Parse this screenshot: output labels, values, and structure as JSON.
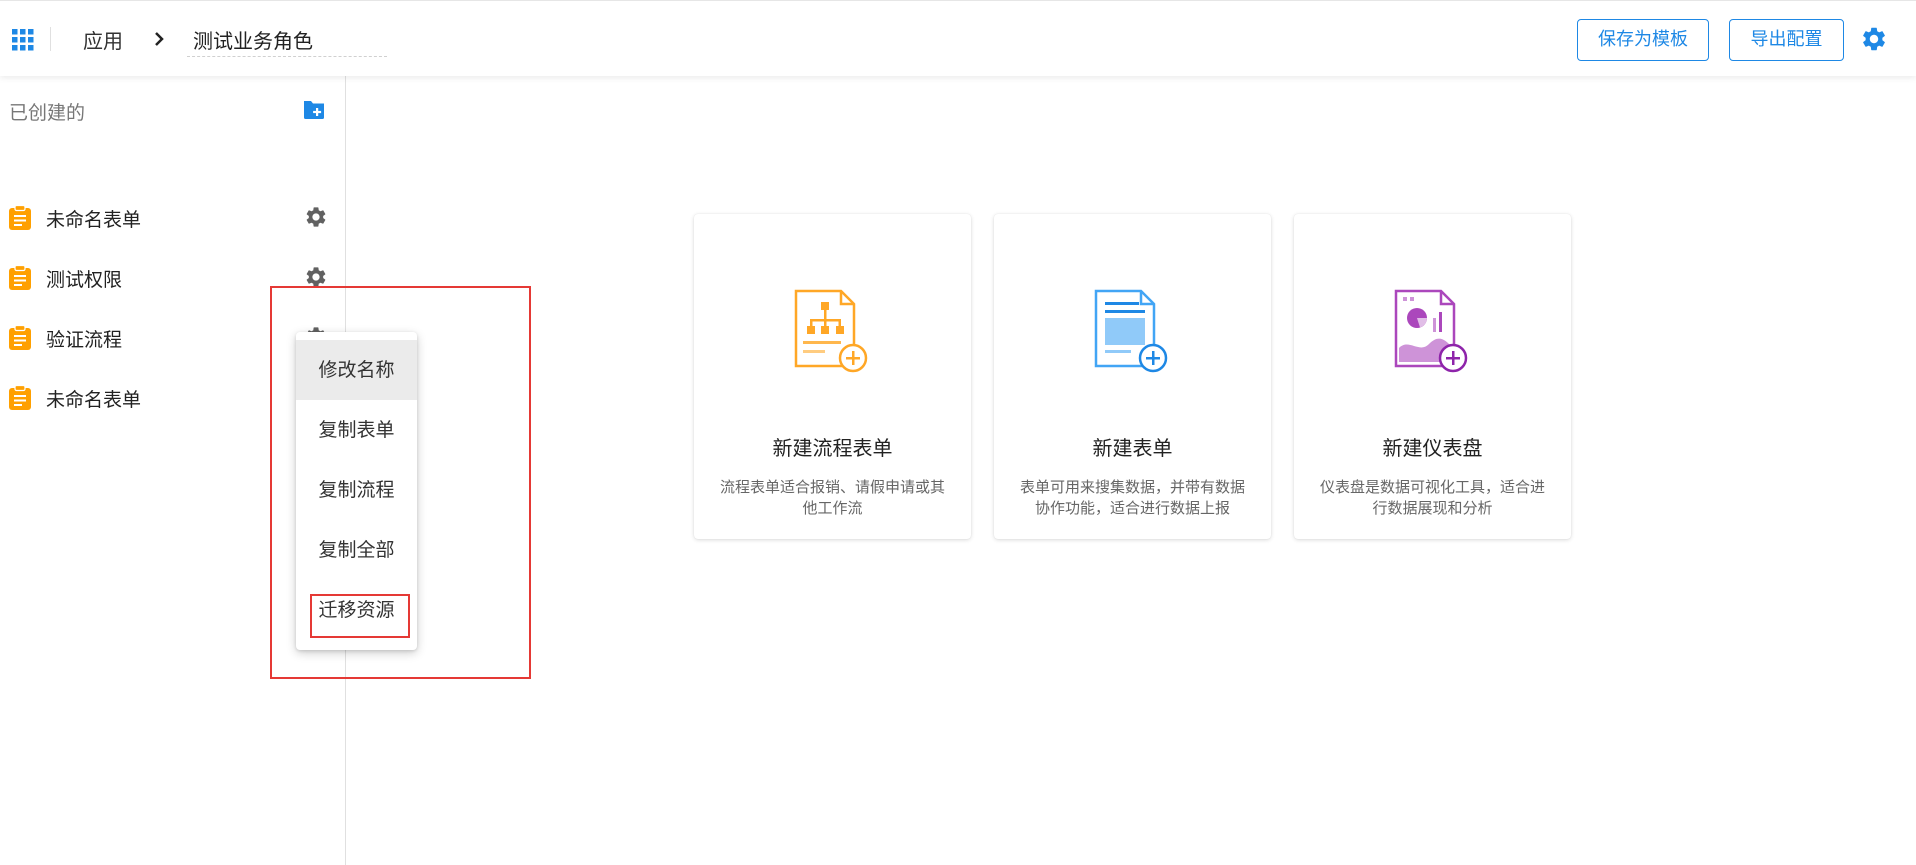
{
  "header": {
    "breadcrumb_app": "应用",
    "breadcrumb_current": "测试业务角色",
    "save_template_label": "保存为模板",
    "export_config_label": "导出配置"
  },
  "sidebar": {
    "title": "已创建的",
    "items": [
      {
        "label": "未命名表单"
      },
      {
        "label": "测试权限"
      },
      {
        "label": "验证流程"
      },
      {
        "label": "未命名表单"
      }
    ]
  },
  "context_menu": {
    "items": [
      {
        "label": "修改名称"
      },
      {
        "label": "复制表单"
      },
      {
        "label": "复制流程"
      },
      {
        "label": "复制全部"
      },
      {
        "label": "迁移资源"
      }
    ]
  },
  "cards": [
    {
      "title": "新建流程表单",
      "description": "流程表单适合报销、请假申请或其他工作流"
    },
    {
      "title": "新建表单",
      "description": "表单可用来搜集数据，并带有数据协作功能，适合进行数据上报"
    },
    {
      "title": "新建仪表盘",
      "description": "仪表盘是数据可视化工具，适合进行数据展现和分析"
    }
  ],
  "colors": {
    "accent": "#1e88e5",
    "doc_icon": "#ffa000",
    "workflow_card": "#ffa726",
    "form_card": "#42a5f5",
    "dashboard_card": "#ab47bc",
    "highlight": "#e53935"
  }
}
